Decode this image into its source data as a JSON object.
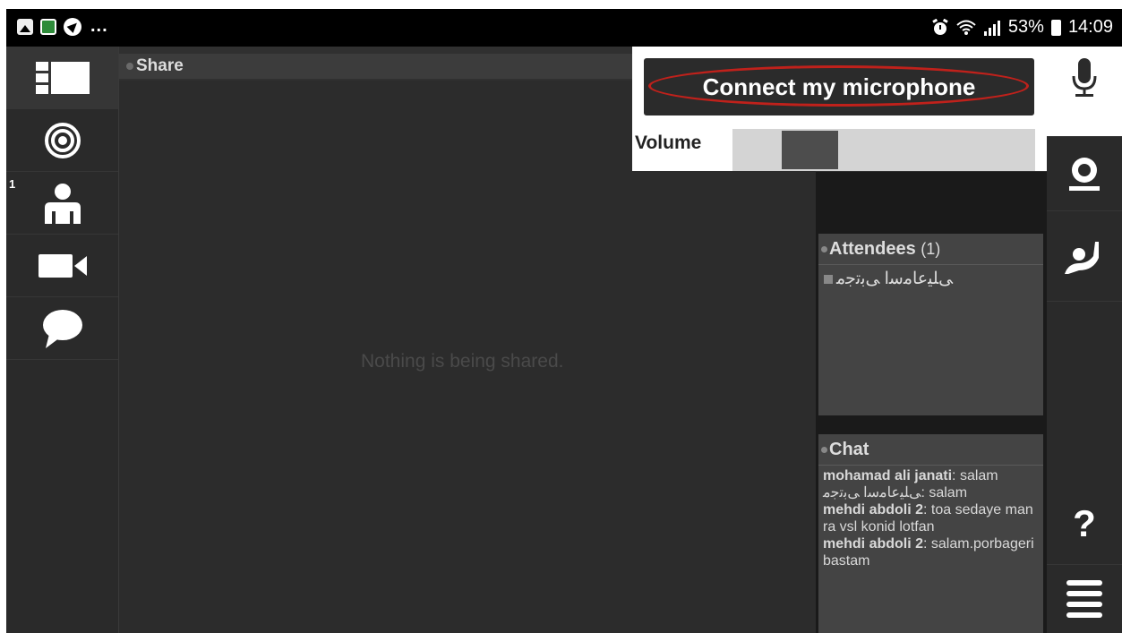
{
  "statusbar": {
    "left_more": "...",
    "battery": "53%",
    "time": "14:09"
  },
  "leftnav": {
    "attendee_badge": "1"
  },
  "share": {
    "title": "Share",
    "empty_message": "Nothing is being shared."
  },
  "mic_popup": {
    "connect_label": "Connect my microphone",
    "volume_label": "Volume",
    "volume_level": 0.22
  },
  "attendees": {
    "title": "Attendees",
    "count": "(1)",
    "items": [
      {
        "name": "ﻰﻠﯿﻋﺎﻣﺳا ﻰﺑﺗﺟﻣ"
      }
    ]
  },
  "chat": {
    "title": "Chat",
    "messages": [
      {
        "author": "mohamad ali janati",
        "text": ": salam"
      },
      {
        "author": "ﻰﻠﯿﻋﺎﻣﺳا ﻰﺑﺗﺟﻣ",
        "text": ": salam"
      },
      {
        "author": "mehdi abdoli 2",
        "text": ": toa sedaye man ra vsl konid lotfan"
      },
      {
        "author": "mehdi abdoli 2",
        "text": ": salam.porbageri bastam"
      }
    ]
  },
  "right_tools": {
    "help": "?"
  },
  "colors": {
    "highlight": "#c0211b",
    "panel": "#444444"
  }
}
